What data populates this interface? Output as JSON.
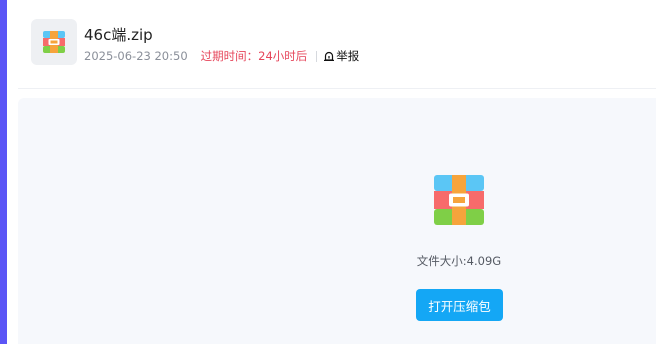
{
  "file": {
    "name": "46c端.zip",
    "date": "2025-06-23 20:50",
    "expire_label": "过期时间：24小时后",
    "report_label": "举报",
    "size_text": "文件大小:4.09G",
    "icon": "archive-icon"
  },
  "actions": {
    "open_label": "打开压缩包"
  },
  "colors": {
    "accent_rail": "#5b55f6",
    "expire_text": "#e6455a",
    "button": "#14a7f5",
    "panel_bg": "#f6f8fc",
    "archive_top": "#5bc6f5",
    "archive_middle": "#f76b6b",
    "archive_bottom": "#7fcf47",
    "archive_strap": "#f6a43c"
  }
}
